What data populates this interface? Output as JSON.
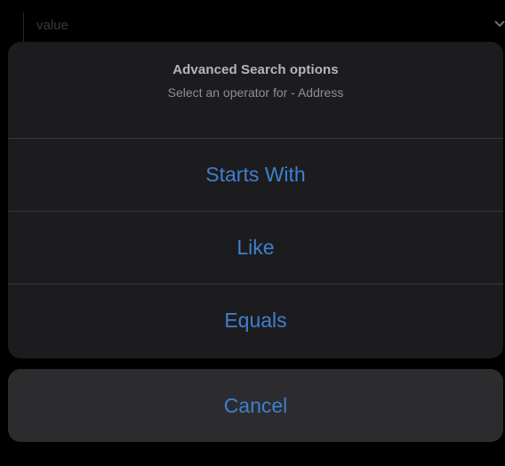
{
  "background": {
    "field_value": "value",
    "chevron_icon": "chevron-down-icon"
  },
  "action_sheet": {
    "title": "Advanced Search options",
    "message": "Select an operator for - Address",
    "actions": [
      {
        "label": "Starts With"
      },
      {
        "label": "Like"
      },
      {
        "label": "Equals"
      }
    ],
    "cancel_label": "Cancel"
  },
  "colors": {
    "background": "#000000",
    "sheet": "#1c1c1e",
    "cancel": "#2c2c2e",
    "action_text": "#3f7fd1",
    "divider": "#38383a"
  }
}
